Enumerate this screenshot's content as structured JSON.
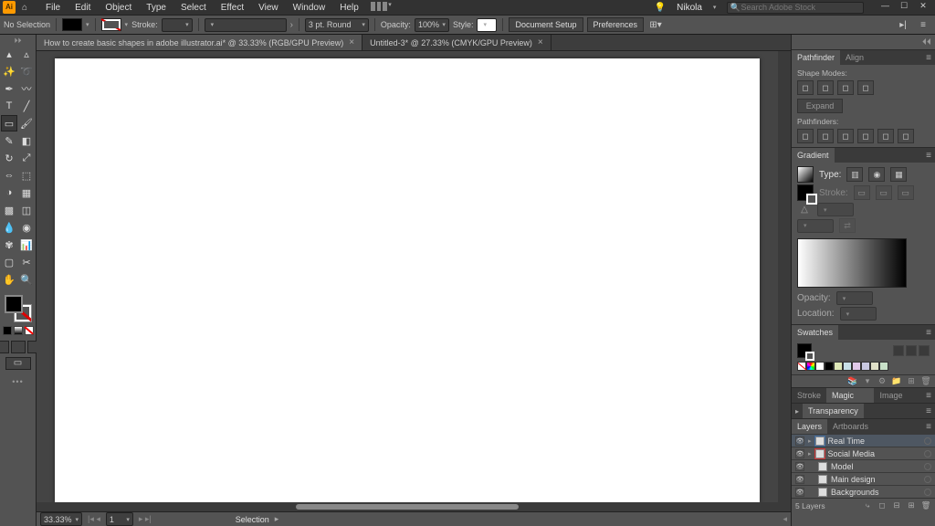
{
  "menu": {
    "items": [
      "File",
      "Edit",
      "Object",
      "Type",
      "Select",
      "Effect",
      "View",
      "Window",
      "Help"
    ],
    "user": "Nikola",
    "search_ph": "Search Adobe Stock"
  },
  "control": {
    "selection_label": "No Selection",
    "stroke_label": "Stroke:",
    "stroke_weight": "",
    "brush_label": "3 pt. Round",
    "opacity_label": "Opacity:",
    "opacity_value": "100%",
    "style_label": "Style:",
    "doc_setup": "Document Setup",
    "prefs": "Preferences"
  },
  "tabs": {
    "active_label": "How to create basic shapes in adobe illustrator.ai* @ 33.33% (RGB/GPU Preview)",
    "inactive_label": "Untitled-3* @ 27.33% (CMYK/GPU Preview)"
  },
  "status": {
    "zoom": "33.33%",
    "artboard": "1",
    "tool": "Selection"
  },
  "panels": {
    "pathfinder": {
      "tab1": "Pathfinder",
      "tab2": "Align",
      "group1": "Shape Modes:",
      "group2": "Pathfinders:",
      "expand": "Expand"
    },
    "gradient": {
      "title": "Gradient",
      "type_label": "Type:",
      "stroke_label": "Stroke:",
      "opacity_label": "Opacity:",
      "location_label": "Location:"
    },
    "swatches": {
      "title": "Swatches",
      "colors": [
        "#ffffff",
        "#000000",
        "#dfe8b8",
        "#c8e0e8",
        "#e0c8e8",
        "#c8c8e0",
        "#e0e0c8",
        "#c8e0c8"
      ]
    },
    "middle_tabs": [
      "Stroke",
      "Magic Wand",
      "Image Trace"
    ],
    "transparency": "Transparency",
    "layers": {
      "tab1": "Layers",
      "tab2": "Artboards",
      "rows": [
        {
          "name": "Real Time",
          "visible": true,
          "selected": true,
          "color": "#3d6a9e"
        },
        {
          "name": "Social Media",
          "visible": true,
          "selected": false,
          "color": "#cc3333"
        },
        {
          "name": "Model",
          "visible": true,
          "selected": false,
          "color": "#777"
        },
        {
          "name": "Main design",
          "visible": true,
          "selected": false,
          "color": "#777"
        },
        {
          "name": "Backgrounds",
          "visible": true,
          "selected": false,
          "color": "#777"
        }
      ],
      "count": "5 Layers"
    }
  }
}
